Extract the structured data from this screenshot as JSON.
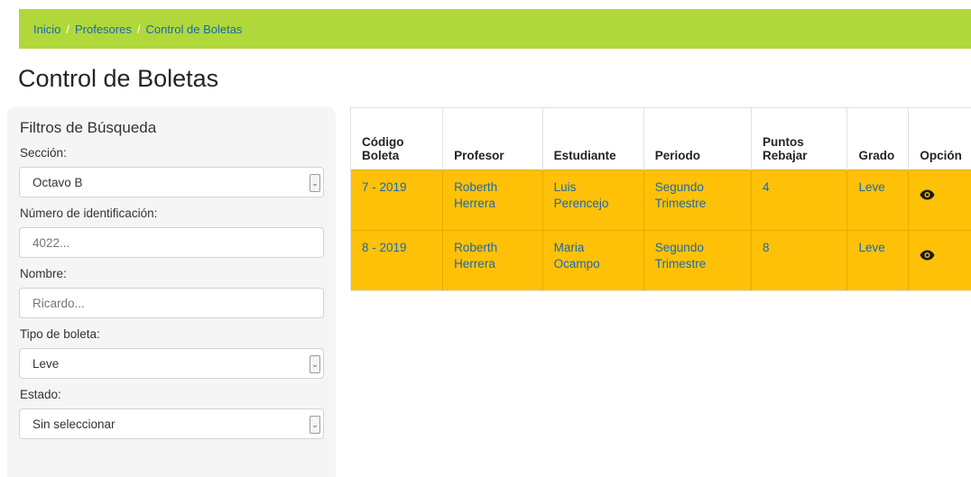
{
  "breadcrumb": {
    "items": [
      "Inicio",
      "Profesores",
      "Control de Boletas"
    ],
    "separator": "/"
  },
  "page": {
    "title": "Control de Boletas"
  },
  "filters": {
    "title": "Filtros de Búsqueda",
    "seccion": {
      "label": "Sección:",
      "value": "Octavo B"
    },
    "numero": {
      "label": "Número de identificación:",
      "placeholder": "4022..."
    },
    "nombre": {
      "label": "Nombre:",
      "placeholder": "Ricardo..."
    },
    "tipo": {
      "label": "Tipo de boleta:",
      "value": "Leve"
    },
    "estado": {
      "label": "Estado:",
      "value": "Sin seleccionar"
    }
  },
  "table": {
    "headers": {
      "codigo": [
        "Código",
        "Boleta"
      ],
      "profesor": "Profesor",
      "estudiante": "Estudiante",
      "periodo": "Periodo",
      "puntos": [
        "Puntos",
        "Rebajar"
      ],
      "grado": "Grado",
      "opciones": "Opción"
    },
    "rows": [
      {
        "codigo": "7 - 2019",
        "profesor": [
          "Roberth",
          "Herrera"
        ],
        "estudiante": [
          "Luis",
          "Perencejo"
        ],
        "periodo": [
          "Segundo",
          "Trimestre"
        ],
        "puntos": "4",
        "grado": "Leve"
      },
      {
        "codigo": "8 - 2019",
        "profesor": [
          "Roberth",
          "Herrera"
        ],
        "estudiante": [
          "Maria",
          "Ocampo"
        ],
        "periodo": [
          "Segundo",
          "Trimestre"
        ],
        "puntos": "8",
        "grado": "Leve"
      }
    ],
    "row_color": "#ffc107",
    "action_icon": "eye-icon"
  },
  "colors": {
    "breadcrumb_bg": "#b0d83b",
    "link": "#1669b7"
  }
}
